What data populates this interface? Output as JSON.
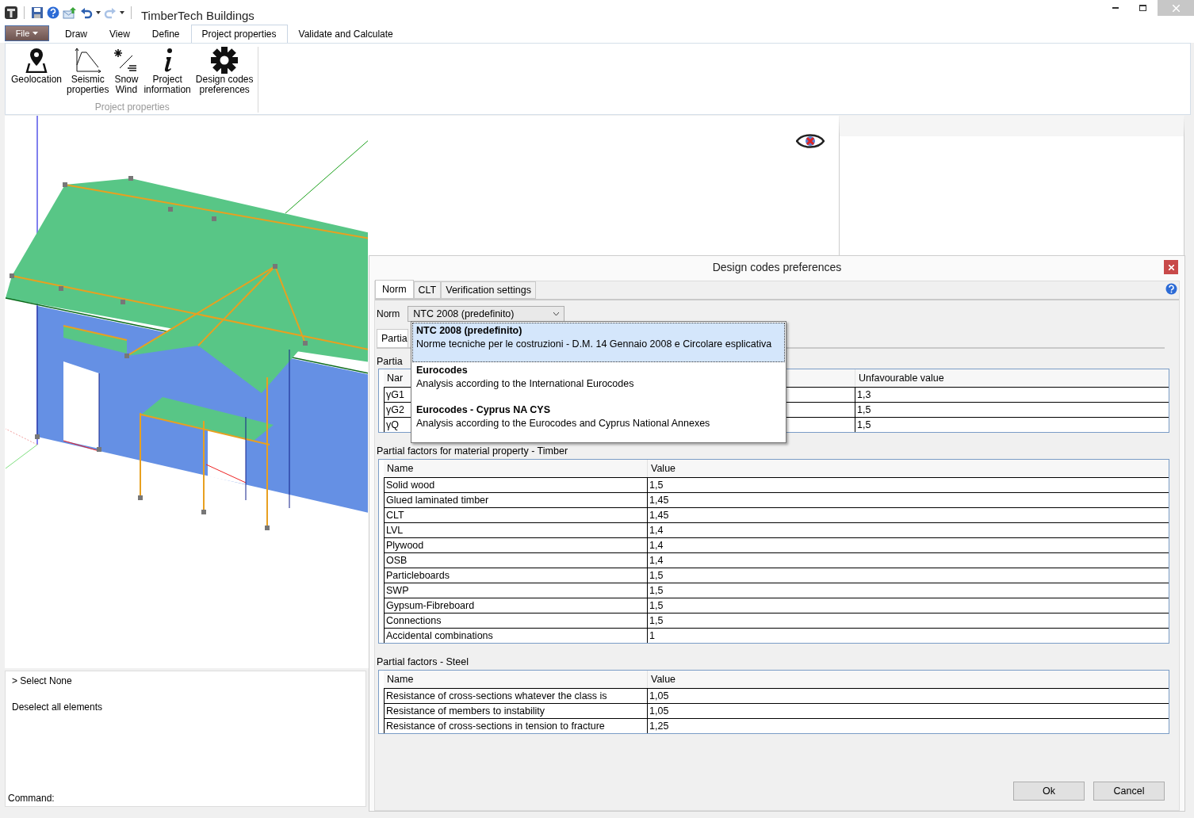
{
  "window": {
    "title": "TimberTech Buildings"
  },
  "ribbon": {
    "file_button": "File",
    "tabs": [
      {
        "label": "Draw",
        "selected": false
      },
      {
        "label": "View",
        "selected": false
      },
      {
        "label": "Define",
        "selected": false
      },
      {
        "label": "Project properties",
        "selected": true
      },
      {
        "label": "Validate and Calculate",
        "selected": false
      }
    ],
    "buttons": [
      {
        "label": "Geolocation",
        "kind": "geolocation"
      },
      {
        "label": "Seismic\nproperties",
        "kind": "seismic"
      },
      {
        "label": "Snow\nWind",
        "kind": "snow_wind"
      },
      {
        "label": "Project\ninformation",
        "kind": "info"
      },
      {
        "label": "Design codes\npreferences",
        "kind": "gear"
      }
    ],
    "group_label": "Project properties"
  },
  "command_panel": {
    "lines": [
      "> Select None",
      "Deselect all elements"
    ],
    "command_label": "Command:"
  },
  "dialog": {
    "title": "Design codes preferences",
    "tabs": [
      {
        "label": "Norm",
        "selected": true
      },
      {
        "label": "CLT",
        "selected": false
      },
      {
        "label": "Verification settings",
        "selected": false
      }
    ],
    "norm_label": "Norm",
    "norm_value": "NTC 2008 (predefinito)",
    "norm_options": [
      {
        "title": "NTC 2008 (predefinito)",
        "description": "Norme tecniche per le costruzioni - D.M. 14 Gennaio 2008 e Circolare esplicativa",
        "selected": true
      },
      {
        "title": "Eurocodes",
        "description": "Analysis according to the International Eurocodes",
        "selected": false
      },
      {
        "title": "Eurocodes - Cyprus NA CYS",
        "description": "Analysis according to the Eurocodes and Cyprus National Annexes",
        "selected": false
      }
    ],
    "subtab": "Partia",
    "sections": [
      {
        "kind": "covered",
        "title": "Partia",
        "columns": [
          "Nar",
          "Unfavourable value"
        ],
        "rows": [
          [
            "γG1",
            "1,3"
          ],
          [
            "γG2",
            "1,5"
          ],
          [
            "γQ",
            "1,5"
          ]
        ]
      },
      {
        "kind": "plain",
        "title": "Partial factors for material property - Timber",
        "columns": [
          "Name",
          "Value"
        ],
        "rows": [
          [
            "Solid wood",
            "1,5"
          ],
          [
            "Glued laminated timber",
            "1,45"
          ],
          [
            "CLT",
            "1,45"
          ],
          [
            "LVL",
            "1,4"
          ],
          [
            "Plywood",
            "1,4"
          ],
          [
            "OSB",
            "1,4"
          ],
          [
            "Particleboards",
            "1,5"
          ],
          [
            "SWP",
            "1,5"
          ],
          [
            "Gypsum-Fibreboard",
            "1,5"
          ],
          [
            "Connections",
            "1,5"
          ],
          [
            "Accidental combinations",
            "1"
          ]
        ]
      },
      {
        "kind": "plain",
        "title": "Partial factors - Steel",
        "columns": [
          "Name",
          "Value"
        ],
        "rows": [
          [
            "Resistance of cross-sections whatever the class is",
            "1,05"
          ],
          [
            "Resistance of members to instability",
            "1,05"
          ],
          [
            "Resistance of cross-sections in tension to fracture",
            "1,25"
          ]
        ]
      }
    ],
    "buttons": [
      "Ok",
      "Cancel"
    ]
  }
}
